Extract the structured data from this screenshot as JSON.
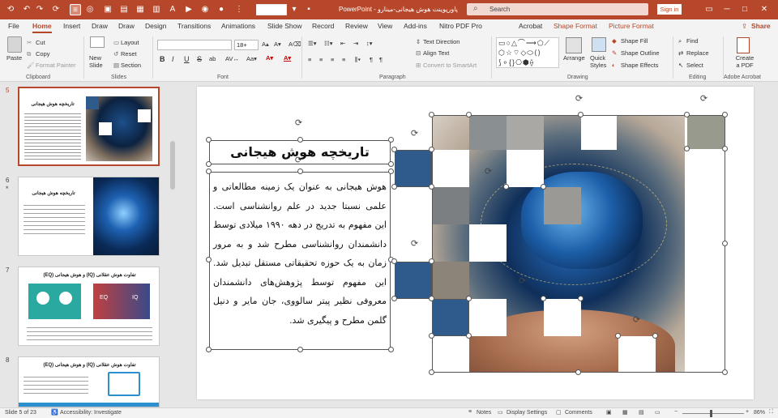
{
  "window": {
    "title": "پاورپوینت هوش هیجانی-مینارو  -  PowerPoint",
    "search_placeholder": "Search",
    "signin": "Sign in",
    "font_size": "18+"
  },
  "tabs": {
    "file": "File",
    "home": "Home",
    "insert": "Insert",
    "draw": "Draw",
    "draw2": "Draw",
    "design": "Design",
    "transitions": "Transitions",
    "animations": "Animations",
    "slideshow": "Slide Show",
    "record": "Record",
    "review": "Review",
    "view": "View",
    "addins": "Add-ins",
    "nitro": "Nitro PDF Pro",
    "acrobat": "Acrobat",
    "shapeformat": "Shape Format",
    "pictureformat": "Picture Format",
    "share": "Share"
  },
  "ribbon": {
    "paste": "Paste",
    "cut": "Cut",
    "copy": "Copy",
    "format_painter": "Format Painter",
    "clipboard": "Clipboard",
    "new_slide": "New Slide",
    "layout": "Layout",
    "reset": "Reset",
    "section": "Section",
    "slides": "Slides",
    "font": "Font",
    "bold": "B",
    "italic": "I",
    "underline": "U",
    "strike": "S",
    "shadow": "ab",
    "text_direction": "Text Direction",
    "align_text": "Align Text",
    "convert_smartart": "Convert to SmartArt",
    "paragraph": "Paragraph",
    "arrange": "Arrange",
    "quick_styles": "Quick Styles",
    "shape_fill": "Shape Fill",
    "shape_outline": "Shape Outline",
    "shape_effects": "Shape Effects",
    "drawing": "Drawing",
    "find": "Find",
    "replace": "Replace",
    "select": "Select",
    "editing": "Editing",
    "create_pdf": "Create a PDF",
    "adobe_acrobat": "Adobe Acrobat"
  },
  "thumbs": [
    {
      "num": "5",
      "title": "تاریخچه هوش هیجانی"
    },
    {
      "num": "6",
      "title": "تاریخچه هوش هیجانی"
    },
    {
      "num": "7",
      "title": "تفاوت هوش عقلانی (IQ) و هوش هیجانی (EQ)",
      "eq": "EQ",
      "iq": "IQ"
    },
    {
      "num": "8",
      "title": "تفاوت هوش عقلانی (IQ) و هوش هیجانی (EQ)"
    }
  ],
  "slide": {
    "title": "تاریخچه هوش هیجانی",
    "body": "هوش هیجانی به عنوان یک زمینه مطالعاتی و علمی نسبتا جدید در علم روانشناسی است. این مفهوم به تدریج در دهه ۱۹۹۰ میلادی توسط دانشمندان روانشناسی مطرح شد و به مرور زمان به یک حوزه تحقیقاتی مستقل تبدیل شد. این مفهوم توسط پژوهش‌های دانشمندان معروفی نظیر پیتر سالووی، جان مایر و دنیل گلمن مطرح و پیگیری شد."
  },
  "status": {
    "slide": "Slide 5 of 23",
    "accessibility": "Accessibility: Investigate",
    "notes": "Notes",
    "display": "Display Settings",
    "comments": "Comments",
    "zoom": "86%"
  },
  "colors": {
    "accent": "#b7472a",
    "tile_blue": "#2e5a8c",
    "select": "#555555"
  }
}
